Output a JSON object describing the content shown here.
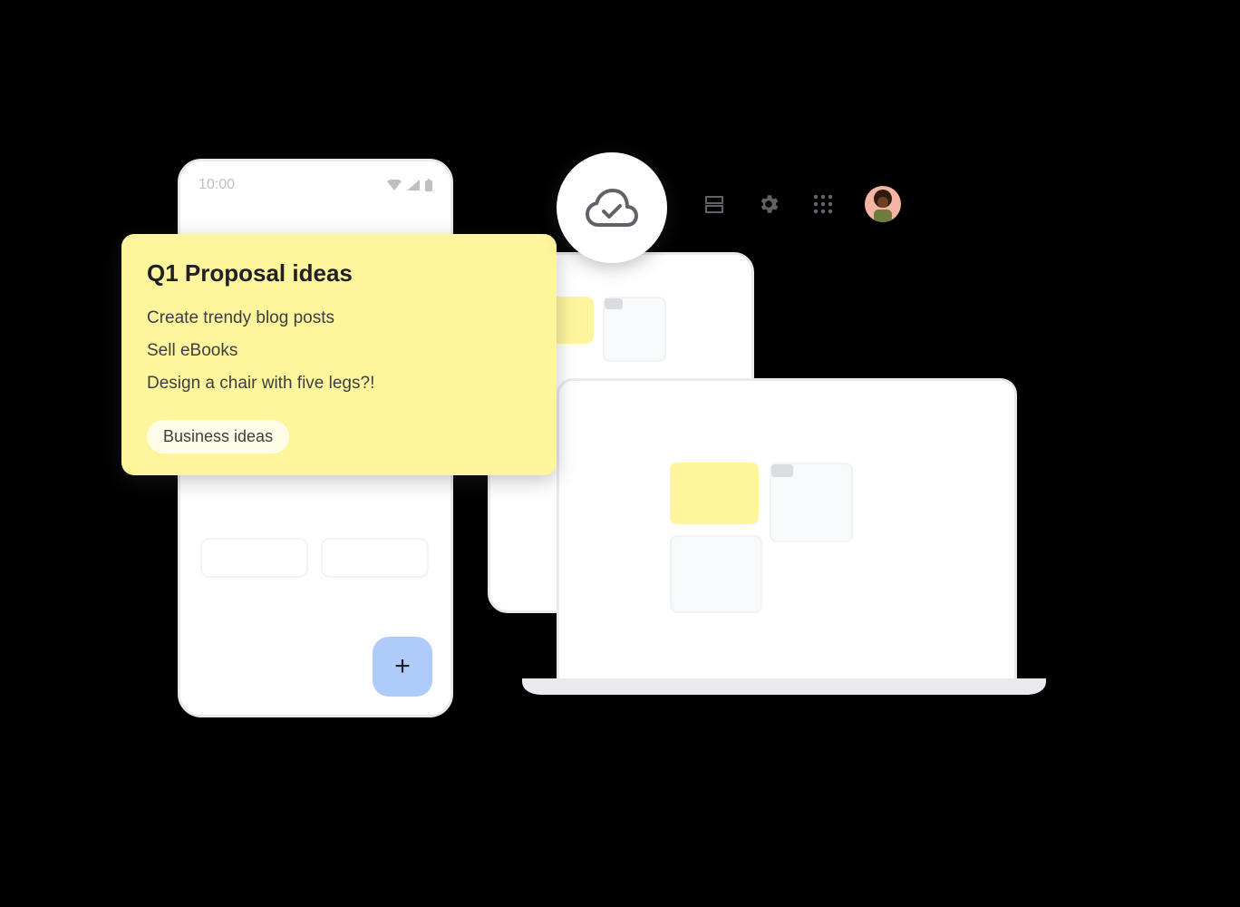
{
  "phone": {
    "time": "10:00",
    "fab_glyph": "+"
  },
  "note": {
    "title": "Q1 Proposal ideas",
    "items": [
      "Create trendy blog posts",
      "Sell eBooks",
      "Design a chair with five legs?!"
    ],
    "chip": "Business ideas"
  },
  "colors": {
    "note_bg": "#FFF59D",
    "fab_bg": "#AECBFA"
  }
}
